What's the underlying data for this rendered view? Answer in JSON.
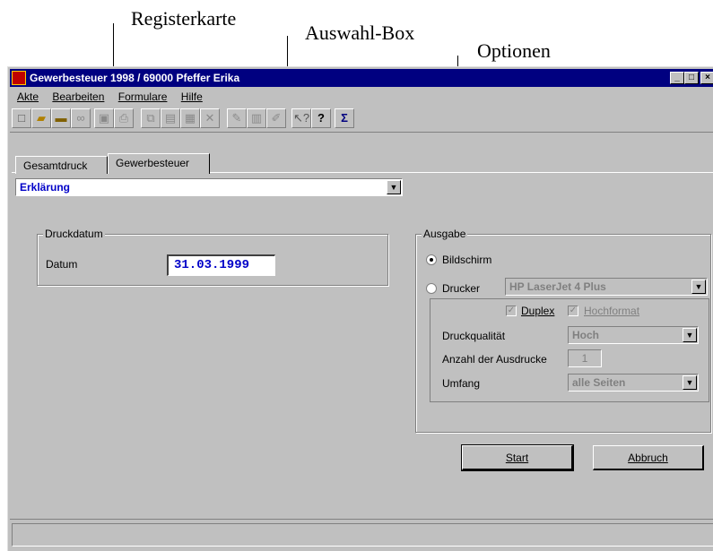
{
  "annotations": {
    "register": "Registerkarte",
    "auswahl": "Auswahl-Box",
    "optionen": "Optionen"
  },
  "window": {
    "title": "Gewerbesteuer 1998 / 69000 Pfeffer Erika",
    "controls": {
      "minimize": "_",
      "maximize": "□",
      "close": "×"
    }
  },
  "menu": [
    "Akte",
    "Bearbeiten",
    "Formulare",
    "Hilfe"
  ],
  "toolbar_icons": [
    "new-doc-icon",
    "open-folder-icon",
    "folder-icon",
    "binoculars-icon",
    "save-icon",
    "print-icon",
    "copy-icon",
    "paste-icon",
    "table-icon",
    "delete-icon",
    "stamp-icon",
    "form-icon",
    "edit-icon",
    "context-help-icon",
    "help-icon",
    "sum-icon"
  ],
  "tabs": {
    "gesamtdruck": "Gesamtdruck",
    "gewerbesteuer": "Gewerbesteuer"
  },
  "selection": {
    "value": "Erklärung"
  },
  "druckdatum": {
    "legend": "Druckdatum",
    "label": "Datum",
    "value": "31.03.1999"
  },
  "ausgabe": {
    "legend": "Ausgabe",
    "bildschirm": "Bildschirm",
    "drucker": "Drucker",
    "drucker_value": "HP LaserJet 4 Plus",
    "duplex": "Duplex",
    "hochformat": "Hochformat",
    "druckqualitaet_label": "Druckqualität",
    "druckqualitaet_value": "Hoch",
    "anzahl_label": "Anzahl der Ausdrucke",
    "anzahl_value": "1",
    "umfang_label": "Umfang",
    "umfang_value": "alle Seiten"
  },
  "buttons": {
    "start": "Start",
    "abbruch": "Abbruch"
  },
  "colors": {
    "titlebar": "#000080",
    "face": "#c0c0c0",
    "accent_text": "#0000c8"
  }
}
